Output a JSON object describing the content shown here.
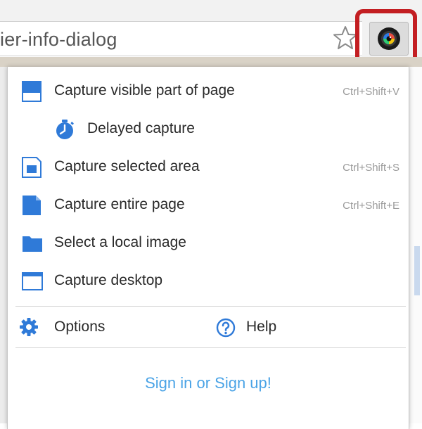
{
  "omnibox": {
    "url_text": "ier-info-dialog"
  },
  "toolbar": {
    "bookmark_icon": "star-outline-icon",
    "extension_icon": "camera-icon",
    "highlight_color": "#c31e22"
  },
  "menu": {
    "items": [
      {
        "label": "Capture visible part of page",
        "shortcut": "Ctrl+Shift+V",
        "icon": "visible-page-icon"
      },
      {
        "label": "Delayed capture",
        "shortcut": "",
        "icon": "timer-icon"
      },
      {
        "label": "Capture selected area",
        "shortcut": "Ctrl+Shift+S",
        "icon": "selected-area-icon"
      },
      {
        "label": "Capture entire page",
        "shortcut": "Ctrl+Shift+E",
        "icon": "entire-page-icon"
      },
      {
        "label": "Select a local image",
        "shortcut": "",
        "icon": "folder-icon"
      },
      {
        "label": "Capture desktop",
        "shortcut": "",
        "icon": "desktop-window-icon"
      }
    ],
    "options_label": "Options",
    "help_label": "Help",
    "signin_label": "Sign in or Sign up!"
  },
  "colors": {
    "accent_blue": "#2f7ad8",
    "link_blue": "#4aa3e6"
  }
}
